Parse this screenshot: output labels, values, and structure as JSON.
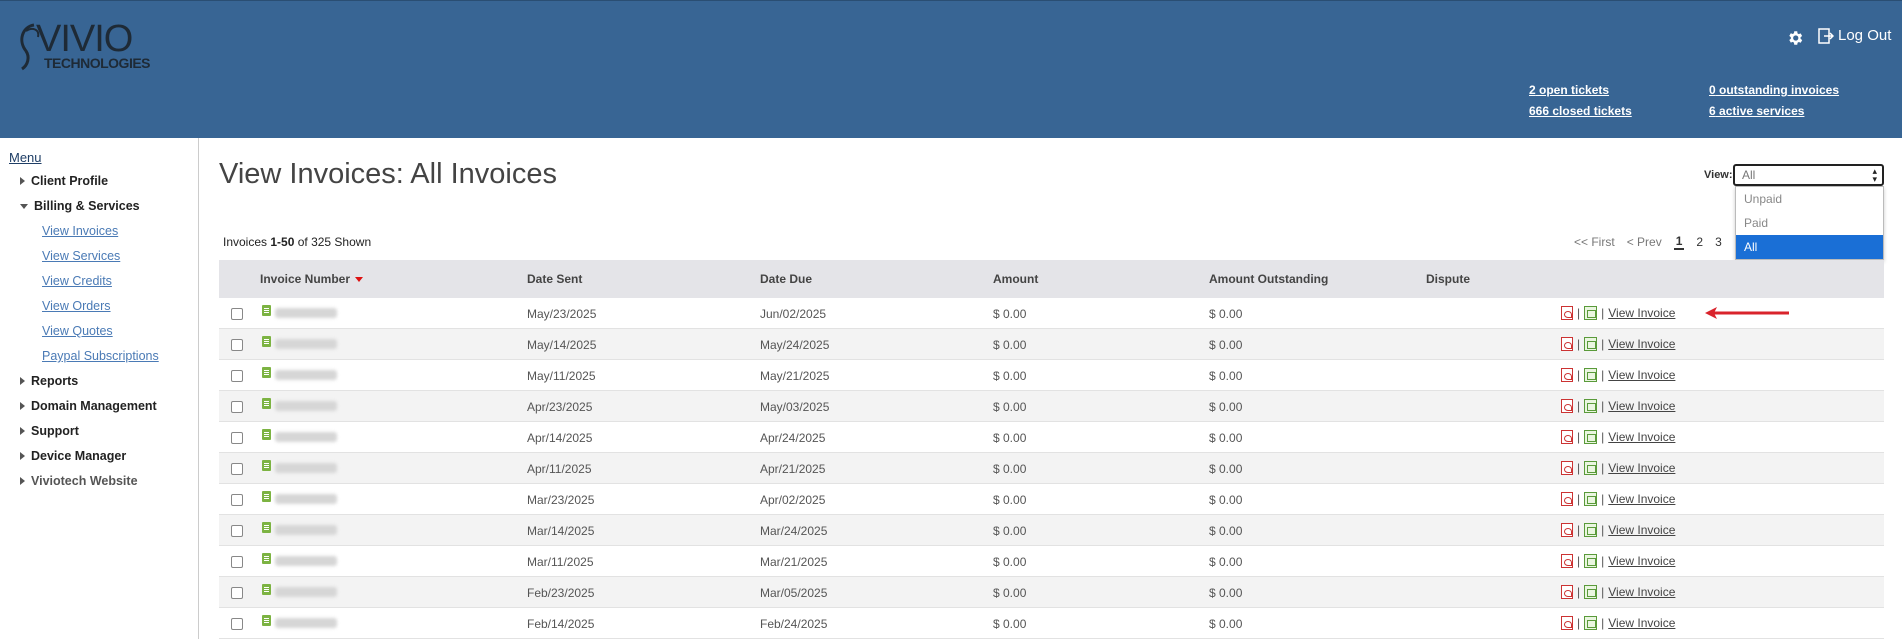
{
  "brand": {
    "logo_main": "VIVIO",
    "logo_sub": "TECHNOLOGIES"
  },
  "header": {
    "settings_icon": "gear-icon",
    "logout_icon": "sign-out-icon",
    "logout_label": "Log Out",
    "stats": {
      "open_tickets_num": "2",
      "open_tickets_label": " open tickets",
      "closed_tickets_num": "666",
      "closed_tickets_label": " closed tickets",
      "outstanding_num": "0",
      "outstanding_label": " outstanding invoices",
      "active_num": "6",
      "active_label": " active services"
    }
  },
  "sidebar": {
    "menu_title": "Menu",
    "items": [
      {
        "label": "Client Profile"
      },
      {
        "label": "Billing & Services"
      },
      {
        "label": "Reports"
      },
      {
        "label": "Domain Management"
      },
      {
        "label": "Support"
      },
      {
        "label": "Device Manager"
      },
      {
        "label": "Viviotech Website"
      }
    ],
    "billing_sub": [
      {
        "label": "View Invoices"
      },
      {
        "label": "View Services"
      },
      {
        "label": "View Credits"
      },
      {
        "label": "View Orders"
      },
      {
        "label": "View Quotes"
      },
      {
        "label": "Paypal Subscriptions"
      }
    ]
  },
  "main": {
    "title": "View Invoices: All Invoices",
    "view_label": "View:",
    "view_selected": "All",
    "view_options": [
      "Unpaid",
      "Paid",
      "All"
    ],
    "count_prefix": "Invoices ",
    "count_range": "1-50",
    "count_suffix": " of 325 Shown",
    "pager": {
      "first": "<< First",
      "prev": "< Prev",
      "pages": [
        "1",
        "2",
        "3"
      ]
    },
    "columns": [
      "Invoice Number",
      "Date Sent",
      "Date Due",
      "Amount",
      "Amount Outstanding",
      "Dispute"
    ],
    "action_label": "View Invoice",
    "separator": "|",
    "rows": [
      {
        "date_sent": "May/23/2025",
        "date_due": "Jun/02/2025",
        "amount": "$ 0.00",
        "outstanding": "$ 0.00"
      },
      {
        "date_sent": "May/14/2025",
        "date_due": "May/24/2025",
        "amount": "$ 0.00",
        "outstanding": "$ 0.00"
      },
      {
        "date_sent": "May/11/2025",
        "date_due": "May/21/2025",
        "amount": "$ 0.00",
        "outstanding": "$ 0.00"
      },
      {
        "date_sent": "Apr/23/2025",
        "date_due": "May/03/2025",
        "amount": "$ 0.00",
        "outstanding": "$ 0.00"
      },
      {
        "date_sent": "Apr/14/2025",
        "date_due": "Apr/24/2025",
        "amount": "$ 0.00",
        "outstanding": "$ 0.00"
      },
      {
        "date_sent": "Apr/11/2025",
        "date_due": "Apr/21/2025",
        "amount": "$ 0.00",
        "outstanding": "$ 0.00"
      },
      {
        "date_sent": "Mar/23/2025",
        "date_due": "Apr/02/2025",
        "amount": "$ 0.00",
        "outstanding": "$ 0.00"
      },
      {
        "date_sent": "Mar/14/2025",
        "date_due": "Mar/24/2025",
        "amount": "$ 0.00",
        "outstanding": "$ 0.00"
      },
      {
        "date_sent": "Mar/11/2025",
        "date_due": "Mar/21/2025",
        "amount": "$ 0.00",
        "outstanding": "$ 0.00"
      },
      {
        "date_sent": "Feb/23/2025",
        "date_due": "Mar/05/2025",
        "amount": "$ 0.00",
        "outstanding": "$ 0.00"
      },
      {
        "date_sent": "Feb/14/2025",
        "date_due": "Feb/24/2025",
        "amount": "$ 0.00",
        "outstanding": "$ 0.00"
      }
    ]
  },
  "colors": {
    "header_bg": "#386594",
    "accent_link": "#4a7ab5",
    "selected_option": "#1a6fd6",
    "arrow": "#d9232b"
  }
}
